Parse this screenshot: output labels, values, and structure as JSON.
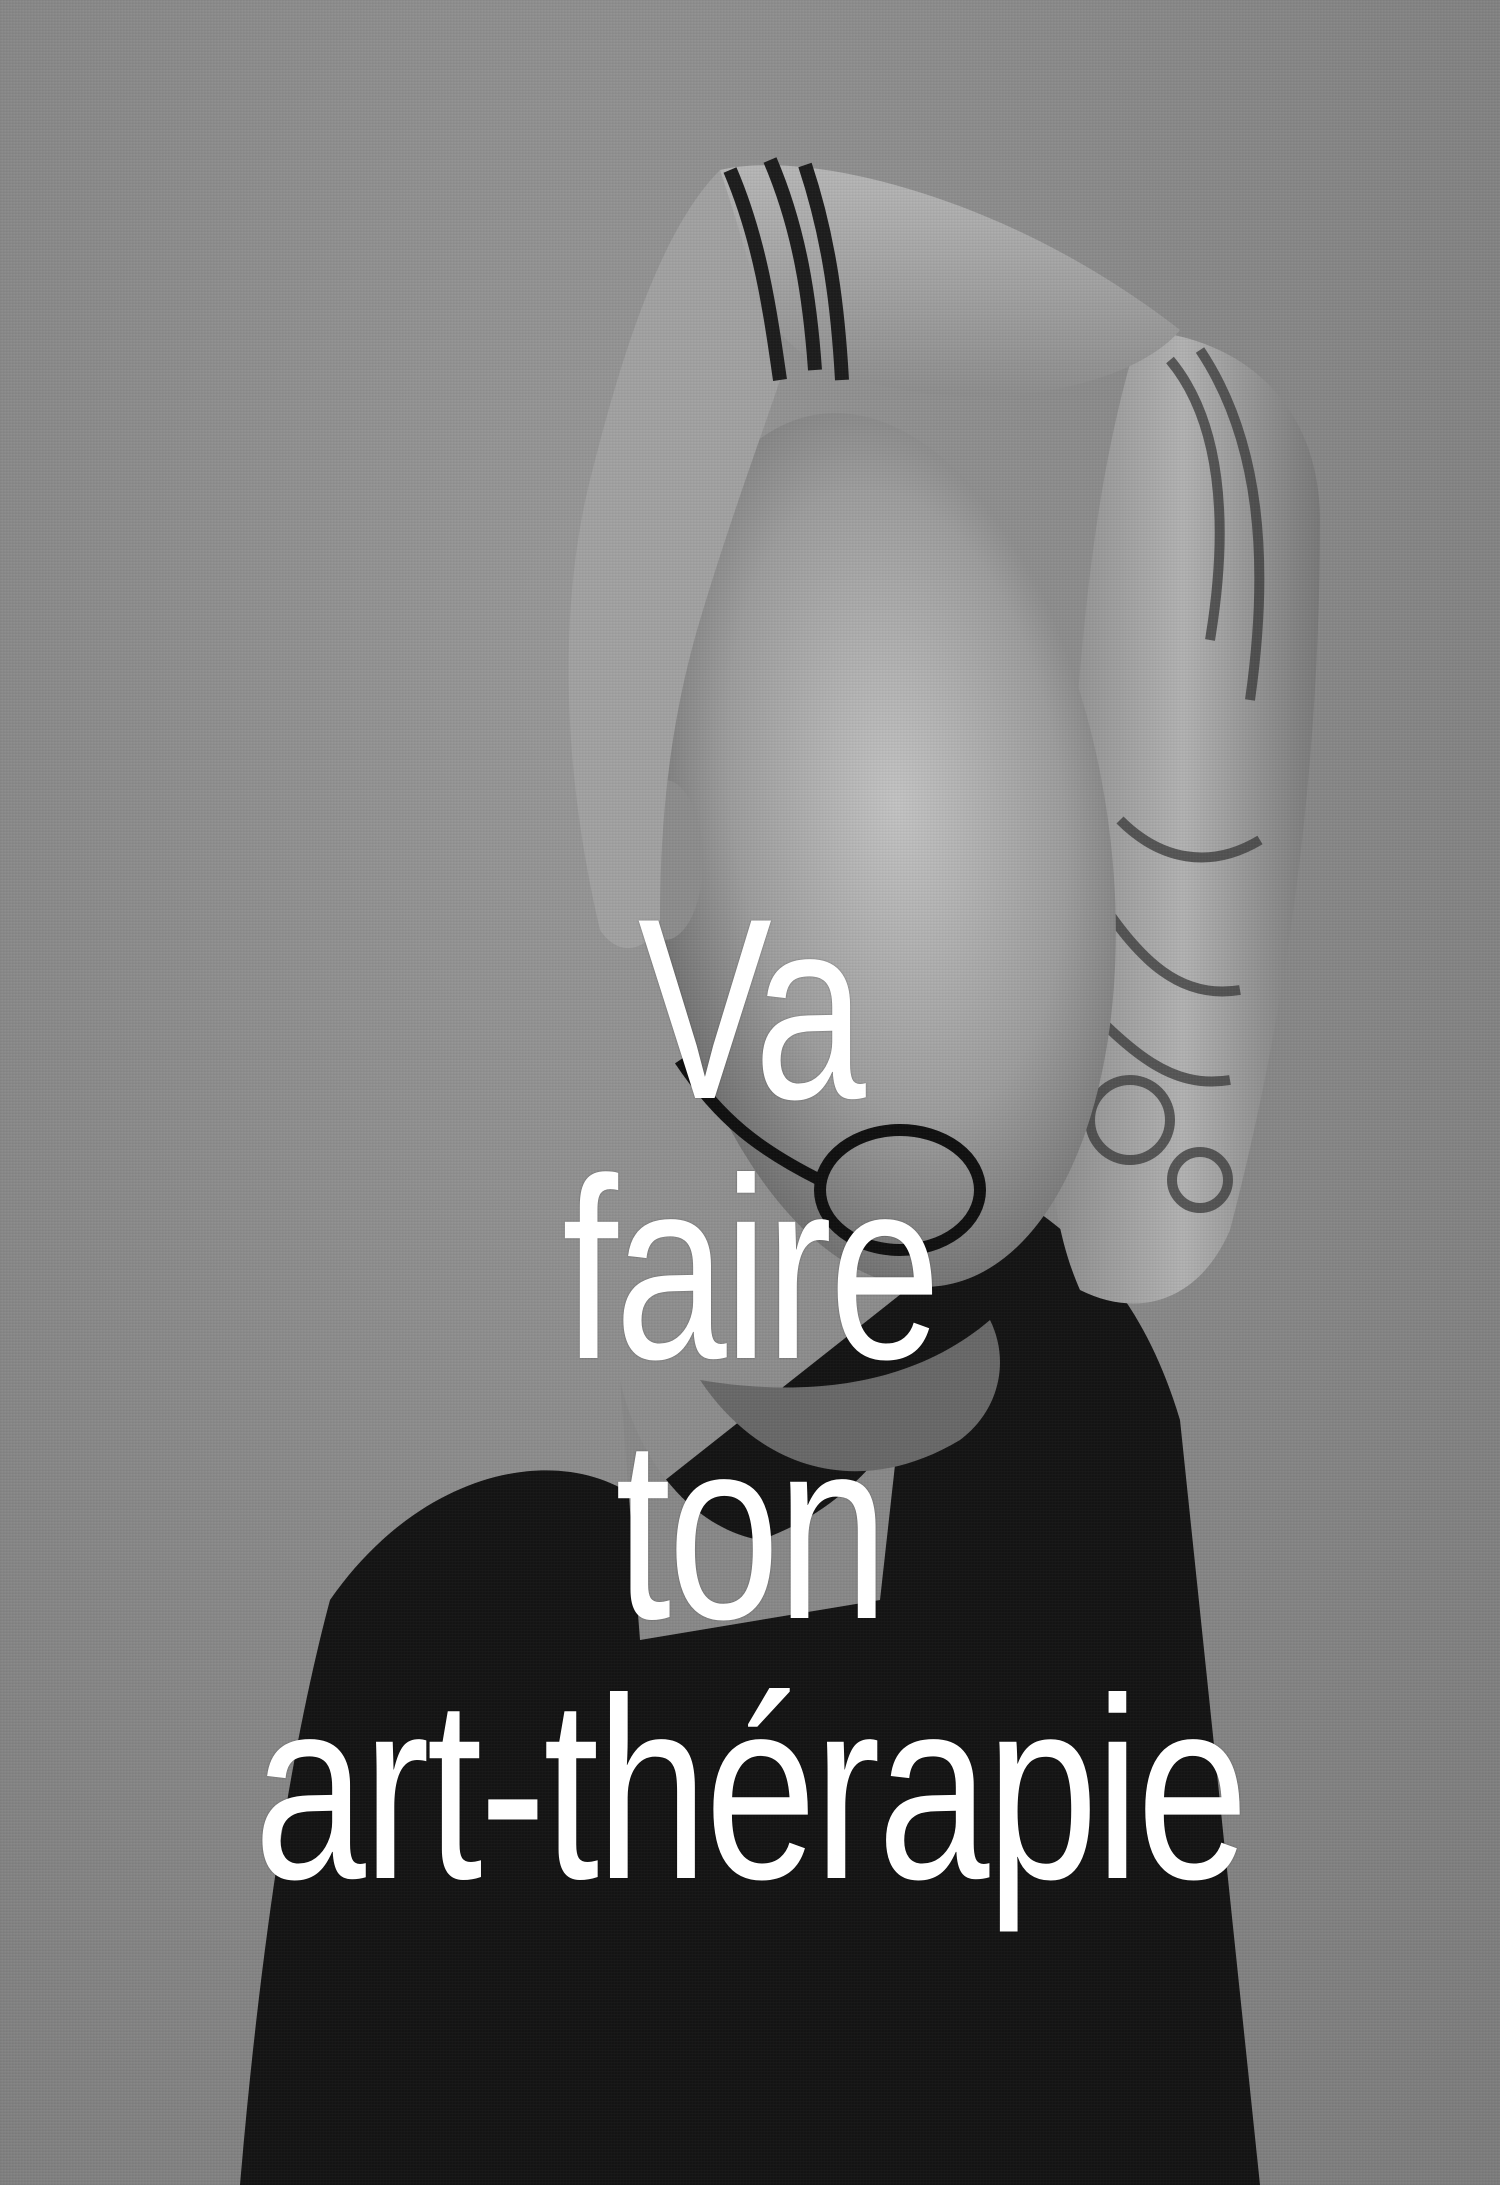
{
  "caption": {
    "line1": "Va",
    "line2": "faire",
    "line3": "ton",
    "line4": "art-thérapie"
  },
  "colors": {
    "background": "#8a8a8a",
    "text": "#ffffff",
    "shirt": "#141414",
    "skin": "#a9a9a9"
  }
}
